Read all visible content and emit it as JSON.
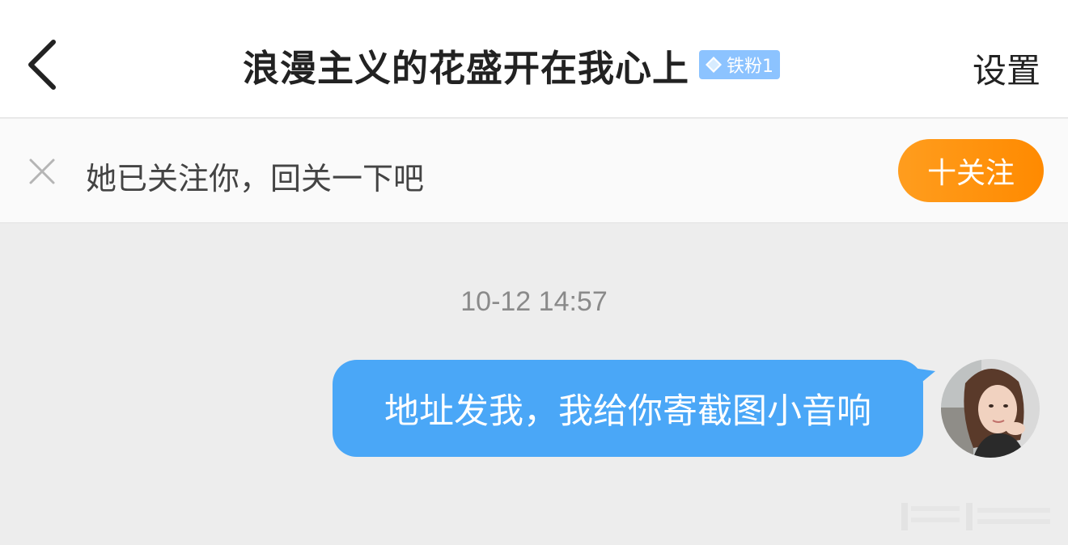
{
  "header": {
    "title": "浪漫主义的花盛开在我心上",
    "badge_label": "铁粉1",
    "settings_label": "设置"
  },
  "follow_bar": {
    "message": "她已关注你，回关一下吧",
    "follow_button_label": "十关注"
  },
  "chat": {
    "timestamp": "10-12 14:57",
    "messages": [
      {
        "text": "地址发我，我给你寄截图小音响",
        "from": "self"
      }
    ]
  },
  "colors": {
    "bubble": "#4aa7f7",
    "follow_button": "#ff9100",
    "badge": "#8cc3ff",
    "chat_background": "#ededed"
  },
  "icons": {
    "back": "chevron-left-icon",
    "close": "close-icon",
    "badge": "diamond-icon"
  }
}
